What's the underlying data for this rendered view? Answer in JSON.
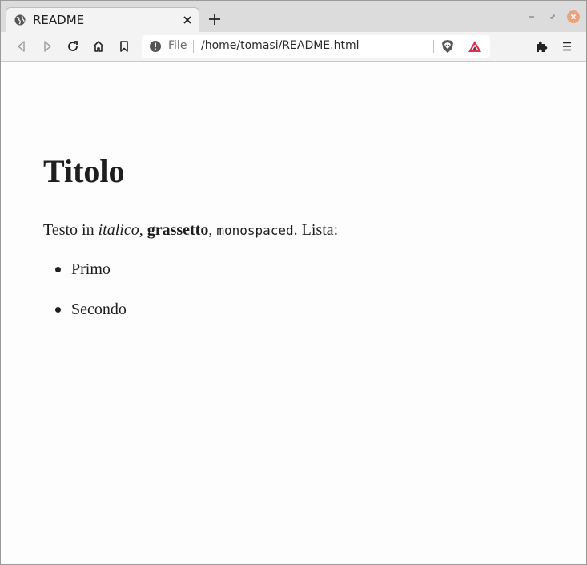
{
  "browser": {
    "tab": {
      "title": "README"
    },
    "addressbar": {
      "scheme_label": "File",
      "url": "/home/tomasi/README.html"
    },
    "icons": {
      "favicon": "globe-icon",
      "tab_close": "close-icon",
      "new_tab": "plus-icon",
      "back": "back-arrow-icon",
      "forward": "forward-arrow-icon",
      "reload": "reload-icon",
      "home": "home-icon",
      "bookmark": "bookmark-icon",
      "info": "info-icon",
      "brave_shields": "lion-shield-icon",
      "rewards": "triangle-rewards-icon",
      "extensions": "puzzle-icon",
      "menu": "hamburger-menu-icon"
    },
    "colors": {
      "close_button": "#e9a27a",
      "rewards": "#e0314b"
    }
  },
  "page": {
    "heading": "Titolo",
    "paragraph": {
      "t1": "Testo in ",
      "italic": "italico",
      "t2": ", ",
      "bold": "grassetto",
      "t3": ", ",
      "mono": "monospaced",
      "t4": ". Lista:"
    },
    "list": [
      "Primo",
      "Secondo"
    ]
  }
}
